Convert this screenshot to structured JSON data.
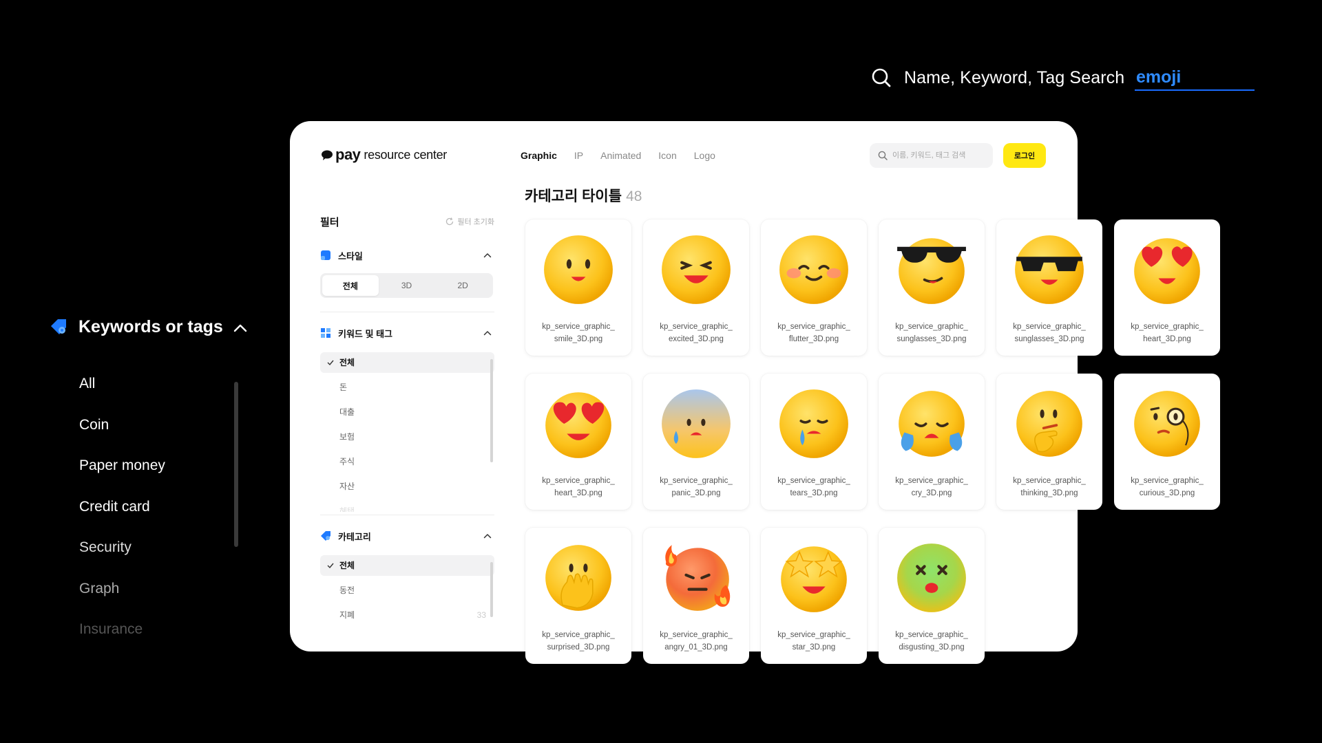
{
  "big_search": {
    "label": "Name, Keyword, Tag Search",
    "value": "emoji"
  },
  "dark_sidebar": {
    "title": "Keywords or tags",
    "items": [
      "All",
      "Coin",
      "Paper money",
      "Credit card",
      "Security",
      "Graph",
      "Insurance"
    ]
  },
  "panel": {
    "logo": {
      "pay": "pay",
      "rest": "resource center"
    },
    "nav": [
      "Graphic",
      "IP",
      "Animated",
      "Icon",
      "Logo"
    ],
    "search_placeholder": "이름, 키워드, 태그 검색",
    "login": "로그인",
    "category_title": "카테고리 타이틀",
    "category_count": "48",
    "filter": {
      "title": "필터",
      "reset": "필터 초기화",
      "style": {
        "title": "스타일",
        "options": [
          "전체",
          "3D",
          "2D"
        ]
      },
      "keywords": {
        "title": "키워드 및 태그",
        "items": [
          "전체",
          "돈",
          "대출",
          "보험",
          "주식",
          "자산",
          "혜택"
        ]
      },
      "category": {
        "title": "카테고리",
        "items": [
          "전체",
          "동전",
          "지폐"
        ],
        "count": "33"
      }
    },
    "cards": [
      {
        "line1": "kp_service_graphic_",
        "line2": "smile_3D.png"
      },
      {
        "line1": "kp_service_graphic_",
        "line2": "excited_3D.png"
      },
      {
        "line1": "kp_service_graphic_",
        "line2": "flutter_3D.png"
      },
      {
        "line1": "kp_service_graphic_",
        "line2": "sunglasses_3D.png"
      },
      {
        "line1": "kp_service_graphic_",
        "line2": "sunglasses_3D.png"
      },
      {
        "line1": "kp_service_graphic_",
        "line2": "heart_3D.png"
      },
      {
        "line1": "kp_service_graphic_",
        "line2": "heart_3D.png"
      },
      {
        "line1": "kp_service_graphic_",
        "line2": "panic_3D.png"
      },
      {
        "line1": "kp_service_graphic_",
        "line2": "tears_3D.png"
      },
      {
        "line1": "kp_service_graphic_",
        "line2": "cry_3D.png"
      },
      {
        "line1": "kp_service_graphic_",
        "line2": "thinking_3D.png"
      },
      {
        "line1": "kp_service_graphic_",
        "line2": "curious_3D.png"
      },
      {
        "line1": "kp_service_graphic_",
        "line2": "surprised_3D.png"
      },
      {
        "line1": "kp_service_graphic_",
        "line2": "angry_01_3D.png"
      },
      {
        "line1": "kp_service_graphic_",
        "line2": "star_3D.png"
      },
      {
        "line1": "kp_service_graphic_",
        "line2": "disgusting_3D.png"
      }
    ]
  },
  "colors": {
    "accent_blue": "#2f8bff",
    "login_yellow": "#ffe812",
    "emoji_yellow": "#fcc21b"
  }
}
